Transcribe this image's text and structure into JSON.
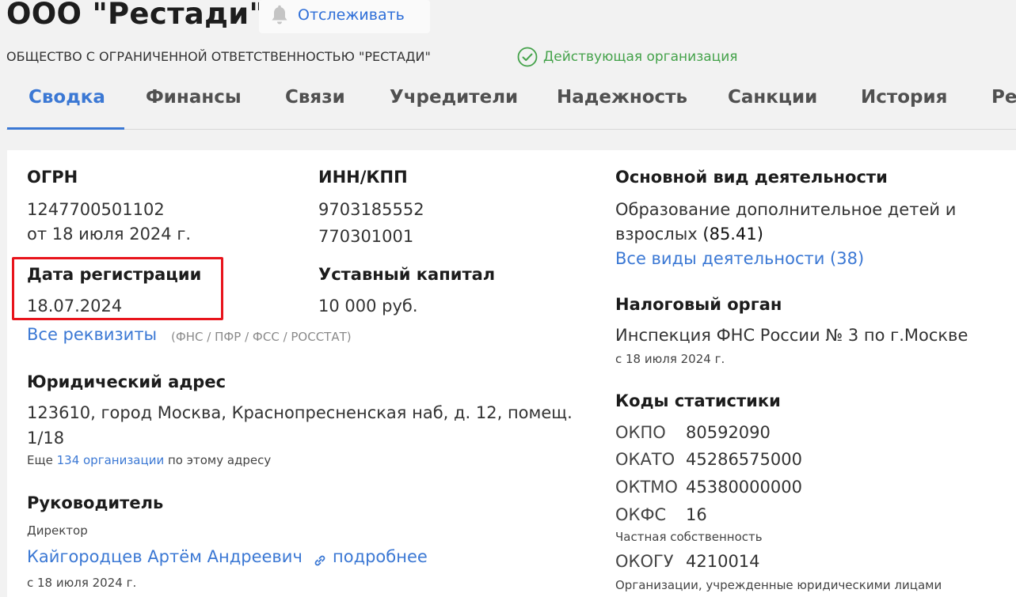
{
  "header": {
    "title": "ООО \"Рестади\"",
    "follow_label": "Отслеживать",
    "full_name": "ОБЩЕСТВО С ОГРАНИЧЕННОЙ ОТВЕТСТВЕННОСТЬЮ \"РЕСТАДИ\"",
    "status": "Действующая организация"
  },
  "tabs": [
    "Сводка",
    "Финансы",
    "Связи",
    "Учредители",
    "Надежность",
    "Санкции",
    "История",
    "Ре"
  ],
  "summary": {
    "ogrn": {
      "label": "ОГРН",
      "value": "1247700501102",
      "date": "от 18 июля 2024 г."
    },
    "inn": {
      "label": "ИНН/КПП",
      "inn": "9703185552",
      "kpp": "770301001"
    },
    "reg_date": {
      "label": "Дата регистрации",
      "value": "18.07.2024"
    },
    "capital": {
      "label": "Уставный капитал",
      "value": "10 000 руб."
    },
    "requisites": {
      "link": "Все реквизиты",
      "sources": "(ФНС / ПФР / ФСС / РОССТАТ)"
    },
    "address": {
      "label": "Юридический адрес",
      "line1": "123610, город Москва, Краснопресненская наб, д. 12, помещ.",
      "line2": "1/18",
      "more_prefix": "Еще ",
      "more_link": "134 организации",
      "more_suffix": " по этому адресу"
    },
    "director": {
      "label": "Руководитель",
      "role": "Директор",
      "name": "Кайгородцев Артём Андреевич",
      "more": "подробнее",
      "since": "с 18 июля 2024 г."
    },
    "activity": {
      "label": "Основной вид деятельности",
      "line1": "Образование дополнительное детей и",
      "line2": "взрослых",
      "code": "(85.41)",
      "all_link": "Все виды деятельности (38)"
    },
    "tax": {
      "label": "Налоговый орган",
      "value": "Инспекция ФНС России № 3 по г.Москве",
      "since": "с 18 июля 2024 г."
    },
    "stats": {
      "label": "Коды статистики",
      "okpo_l": "ОКПО",
      "okpo_v": "80592090",
      "okato_l": "ОКАТО",
      "okato_v": "45286575000",
      "oktmo_l": "ОКТМО",
      "oktmo_v": "45380000000",
      "okfs_l": "ОКФС",
      "okfs_v": "16",
      "okfs_note": "Частная собственность",
      "okogu_l": "ОКОГУ",
      "okogu_v": "4210014",
      "okogu_note": "Организации, учрежденные юридическими лицами"
    }
  },
  "colors": {
    "accent": "#3b78d4",
    "status": "#44a24a",
    "highlight": "#e8141c"
  }
}
